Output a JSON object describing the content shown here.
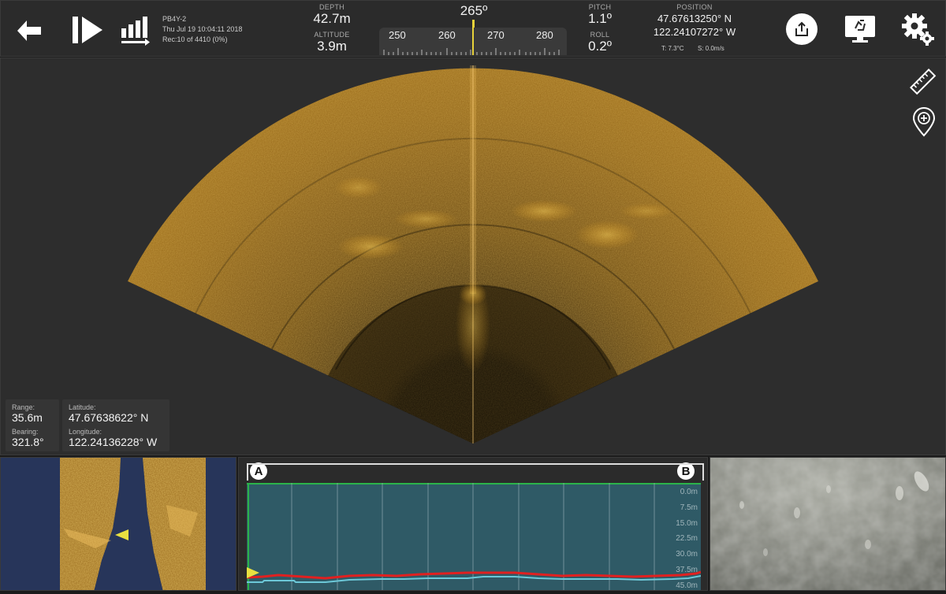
{
  "header": {
    "vessel": "PB4Y-2",
    "datetime": "Thu Jul 19 10:04:11 2018",
    "record": "Rec:10 of 4410 (0%)",
    "depth_label": "DEPTH",
    "depth_value": "42.7m",
    "altitude_label": "ALTITUDE",
    "altitude_value": "3.9m",
    "heading_value": "265º",
    "compass_ticks": [
      "250",
      "260",
      "270",
      "280"
    ],
    "pitch_label": "PITCH",
    "pitch_value": "1.1º",
    "roll_label": "ROLL",
    "roll_value": "0.2º",
    "position_label": "POSITION",
    "position_lat": "47.67613250° N",
    "position_lon": "122.24107272° W",
    "temperature": "T: 7.3°C",
    "speed": "S: 0.0m/s"
  },
  "toolbar": {
    "back_icon": "back-arrow-icon",
    "play_icon": "play-step-icon",
    "signal_icon": "signal-bars-icon",
    "export_icon": "export-icon",
    "display_icon": "display-recycle-icon",
    "settings_icon": "settings-gears-icon"
  },
  "sonar": {
    "range_label": "Range:",
    "range_value": "35.6m",
    "bearing_label": "Bearing:",
    "bearing_value": "321.8°",
    "latitude_label": "Latitude:",
    "latitude_value": "47.67638622° N",
    "longitude_label": "Longitude:",
    "longitude_value": "122.24136228° W",
    "colors": {
      "sonar": "#c98a1e",
      "background": "#2d2d2d"
    }
  },
  "profile": {
    "marker_a": "A",
    "marker_b": "B",
    "depth_labels": [
      "0.0m",
      "7.5m",
      "15.0m",
      "22.5m",
      "30.0m",
      "37.5m",
      "45.0m"
    ],
    "colors": {
      "water": "#2f5a66",
      "depth_line": "#e02020",
      "altitude_line": "#6cc8d8",
      "surface": "#2bb34a"
    }
  }
}
